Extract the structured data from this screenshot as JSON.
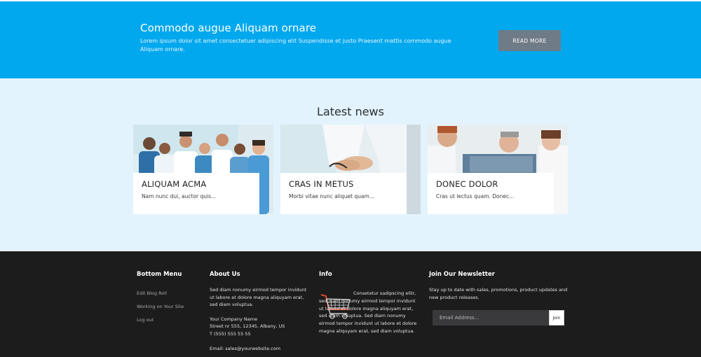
{
  "banner": {
    "title": "Commodo augue Aliquam ornare",
    "description": "Lorem ipsum dolor sit amet consectetuer adipiscing elit Suspendisse et justo Praesent mattis commodo augue Aliquam ornare.",
    "button_label": "READ MORE"
  },
  "news": {
    "heading": "Latest news",
    "cards": [
      {
        "title": "ALIQUAM ACMA",
        "text": "Nam nunc dui, auctor quis..."
      },
      {
        "title": "CRAS IN METUS",
        "text": "Morbi vitae nunc aliquet quam..."
      },
      {
        "title": "DONEC DOLOR",
        "text": "Cras ut lectus quam. Donec..."
      }
    ]
  },
  "footer": {
    "bottom_menu": {
      "heading": "Bottom Menu",
      "links": [
        "Edit Blog Roll",
        "Working on Your Site",
        "Log out"
      ]
    },
    "about": {
      "heading": "About Us",
      "text": "Sed diam nonumy eirmod tempor invidunt ut labore et dolore magna aliquyam erat, sed diam voluptua.",
      "company": "Your Company Name",
      "street": "Street nr 555, 12345, Albany, US",
      "phone": "T (555) 555 55 55",
      "email": "Email: sales@yourwebsite.com"
    },
    "info": {
      "heading": "Info",
      "text": "Consetetur sadipscing elitr, sed diam nonumy eirmod tempor invidunt ut labore et dolore magna aliquyam erat, sed diam voluptua. Sed diam nonumy eirmod tempor invidunt ut labore et dolore magna aliquyam erat, sed diam voluptua.",
      "icon": "shopping-cart-icon"
    },
    "newsletter": {
      "heading": "Join Our Newsletter",
      "text": "Stay up to date with sales, promotions, product updates and new product releases.",
      "email_placeholder": "Email Address...",
      "join_label": "Join"
    }
  },
  "colors": {
    "banner_bg": "#01a8ee",
    "news_bg": "#e3f3fd",
    "footer_bg": "#1c1c1c",
    "button_bg": "#6f7b86"
  }
}
